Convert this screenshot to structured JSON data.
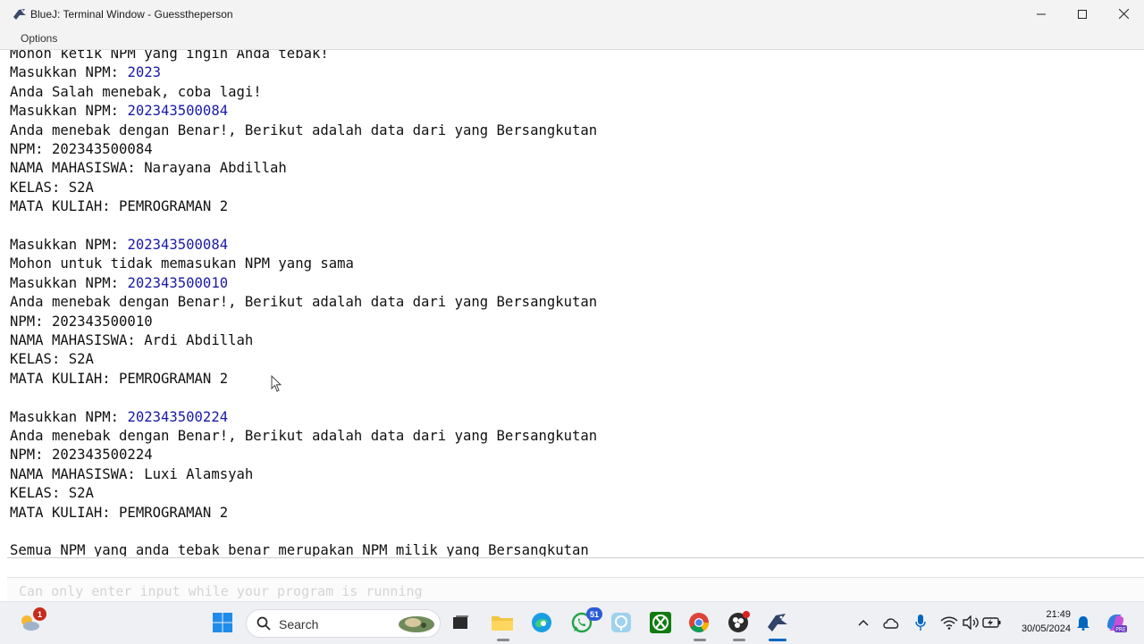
{
  "window": {
    "title": "BlueJ: Terminal Window - Guesstheperson"
  },
  "menu": {
    "options": "Options"
  },
  "terminal": {
    "lines": [
      [
        {
          "t": "Mohon ketik NPM yang ingin Anda tebak!",
          "in": false
        }
      ],
      [
        {
          "t": "Masukkan NPM: ",
          "in": false
        },
        {
          "t": "2023",
          "in": true
        }
      ],
      [
        {
          "t": "Anda Salah menebak, coba lagi!",
          "in": false
        }
      ],
      [
        {
          "t": "Masukkan NPM: ",
          "in": false
        },
        {
          "t": "202343500084",
          "in": true
        }
      ],
      [
        {
          "t": "Anda menebak dengan Benar!, Berikut adalah data dari yang Bersangkutan",
          "in": false
        }
      ],
      [
        {
          "t": "NPM: 202343500084",
          "in": false
        }
      ],
      [
        {
          "t": "NAMA MAHASISWA: Narayana Abdillah",
          "in": false
        }
      ],
      [
        {
          "t": "KELAS: S2A",
          "in": false
        }
      ],
      [
        {
          "t": "MATA KULIAH: PEMROGRAMAN 2",
          "in": false
        }
      ],
      [
        {
          "t": "",
          "in": false
        }
      ],
      [
        {
          "t": "Masukkan NPM: ",
          "in": false
        },
        {
          "t": "202343500084",
          "in": true
        }
      ],
      [
        {
          "t": "Mohon untuk tidak memasukan NPM yang sama",
          "in": false
        }
      ],
      [
        {
          "t": "Masukkan NPM: ",
          "in": false
        },
        {
          "t": "202343500010",
          "in": true
        }
      ],
      [
        {
          "t": "Anda menebak dengan Benar!, Berikut adalah data dari yang Bersangkutan",
          "in": false
        }
      ],
      [
        {
          "t": "NPM: 202343500010",
          "in": false
        }
      ],
      [
        {
          "t": "NAMA MAHASISWA: Ardi Abdillah",
          "in": false
        }
      ],
      [
        {
          "t": "KELAS: S2A",
          "in": false
        }
      ],
      [
        {
          "t": "MATA KULIAH: PEMROGRAMAN 2",
          "in": false
        }
      ],
      [
        {
          "t": "",
          "in": false
        }
      ],
      [
        {
          "t": "Masukkan NPM: ",
          "in": false
        },
        {
          "t": "202343500224",
          "in": true
        }
      ],
      [
        {
          "t": "Anda menebak dengan Benar!, Berikut adalah data dari yang Bersangkutan",
          "in": false
        }
      ],
      [
        {
          "t": "NPM: 202343500224",
          "in": false
        }
      ],
      [
        {
          "t": "NAMA MAHASISWA: Luxi Alamsyah",
          "in": false
        }
      ],
      [
        {
          "t": "KELAS: S2A",
          "in": false
        }
      ],
      [
        {
          "t": "MATA KULIAH: PEMROGRAMAN 2",
          "in": false
        }
      ],
      [
        {
          "t": "",
          "in": false
        }
      ],
      [
        {
          "t": "Semua NPM yang anda tebak benar merupakan NPM milik yang Bersangkutan",
          "in": false
        }
      ]
    ],
    "input_placeholder": "Can only enter input while your program is running"
  },
  "taskbar": {
    "weather_badge": "1",
    "search_label": "Search",
    "whatsapp_badge": "51",
    "time": "21:49",
    "date": "30/05/2024"
  },
  "colors": {
    "input_text": "#1a1aa6",
    "accent": "#0067c0"
  }
}
